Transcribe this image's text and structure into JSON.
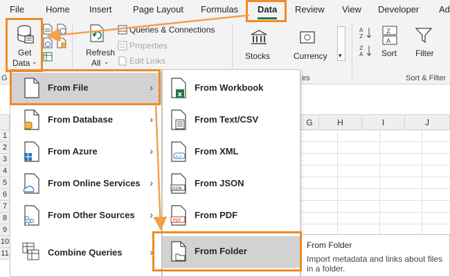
{
  "tabs": [
    "File",
    "Home",
    "Insert",
    "Page Layout",
    "Formulas",
    "Data",
    "Review",
    "View",
    "Developer",
    "Ad"
  ],
  "ribbon": {
    "get_data": "Get",
    "get_data2": "Data",
    "refresh": "Refresh",
    "refresh2": "All",
    "queries_connections": "Queries & Connections",
    "properties": "Properties",
    "edit_links": "Edit Links",
    "stocks": "Stocks",
    "currency": "Currency",
    "sort": "Sort",
    "filter": "Filter",
    "group_g": "G",
    "group_es": "es",
    "group_sort_filter": "Sort & Filter"
  },
  "columns": [
    "G",
    "H",
    "I",
    "J"
  ],
  "rows": [
    "1",
    "2",
    "3",
    "4",
    "5",
    "6",
    "7",
    "8",
    "9",
    "10",
    "11"
  ],
  "menu_main": [
    {
      "label": "From File",
      "key": "F",
      "submenu": true,
      "highlighted": true
    },
    {
      "label": "From Database",
      "key": "D",
      "submenu": true
    },
    {
      "label": "From Azure",
      "key": "A",
      "submenu": true
    },
    {
      "label": "From Online Services",
      "key": "e",
      "submenu": true
    },
    {
      "label": "From Other Sources",
      "key": "O",
      "submenu": true
    },
    {
      "label": "Combine Queries",
      "key": "Q",
      "submenu": true
    }
  ],
  "menu_file": [
    {
      "label": "From Workbook",
      "icon": "excel-workbook-icon"
    },
    {
      "label": "From Text/CSV",
      "icon": "text-file-icon"
    },
    {
      "label": "From XML",
      "icon": "xml-file-icon"
    },
    {
      "label": "From JSON",
      "icon": "json-file-icon"
    },
    {
      "label": "From PDF",
      "icon": "pdf-file-icon"
    },
    {
      "label": "From Folder",
      "icon": "folder-file-icon",
      "highlighted": true
    }
  ],
  "tooltip": {
    "title": "From Folder",
    "description": "Import metadata and links about files in a folder."
  },
  "colors": {
    "accent": "#217346",
    "highlight_border": "#f08a24",
    "arrow": "#f5a04a"
  }
}
